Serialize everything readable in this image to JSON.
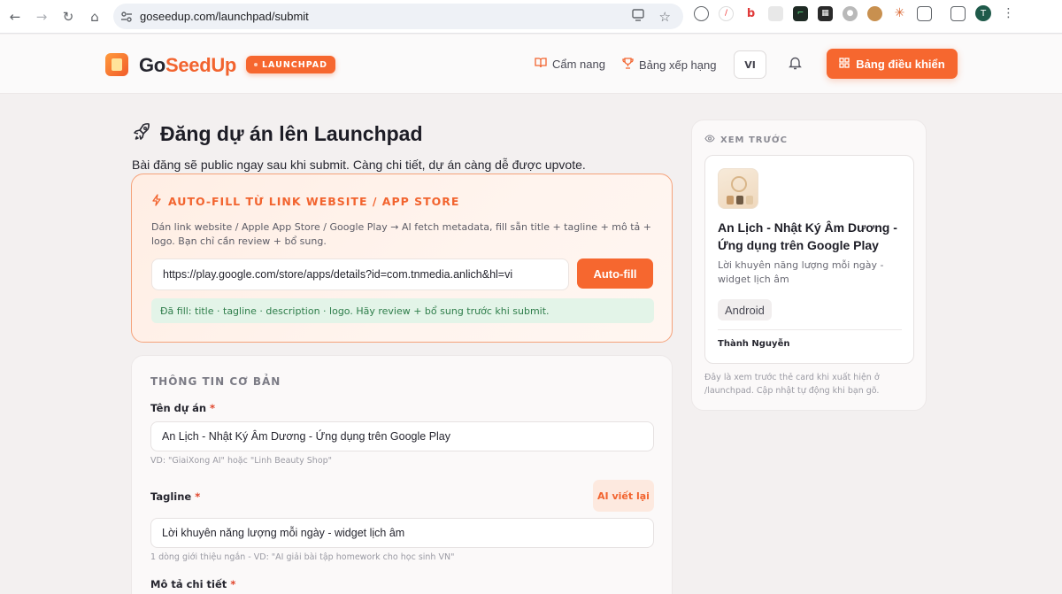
{
  "browser": {
    "url": "goseedup.com/launchpad/submit",
    "profile_initial": "T"
  },
  "header": {
    "brand_go": "Go",
    "brand_seedup": "SeedUp",
    "badge": "LAUNCHPAD",
    "nav": [
      {
        "label": "Cẩm nang",
        "icon": "book-icon"
      },
      {
        "label": "Bảng xếp hạng",
        "icon": "trophy-icon"
      }
    ],
    "lang": "VI",
    "dashboard_label": "Bảng điều khiển"
  },
  "main": {
    "title": "Đăng dự án lên Launchpad",
    "subtitle": "Bài đăng sẽ public ngay sau khi submit. Càng chi tiết, dự án càng dễ được upvote.",
    "autofill": {
      "title": "AUTO-FILL TỪ LINK WEBSITE / APP STORE",
      "description": "Dán link website / Apple App Store / Google Play → AI fetch metadata, fill sẵn title + tagline + mô tả + logo. Bạn chỉ cần review + bổ sung.",
      "url_value": "https://play.google.com/store/apps/details?id=com.tnmedia.anlich&hl=vi",
      "button_label": "Auto-fill",
      "status": "Đã fill: title · tagline · description · logo. Hãy review + bổ sung trước khi submit."
    },
    "basic_info": {
      "section_title": "THÔNG TIN CƠ BẢN",
      "name_label": "Tên dự án",
      "name_value": "An Lịch - Nhật Ký Âm Dương - Ứng dụng trên Google Play",
      "name_hint": "VD: \"GiaiXong AI\" hoặc \"Linh Beauty Shop\"",
      "tagline_label": "Tagline",
      "ai_rewrite_label": "AI viết lại",
      "tagline_value": "Lời khuyên năng lượng mỗi ngày - widget lịch âm",
      "tagline_hint": "1 dòng giới thiệu ngắn - VD: \"AI giải bài tập homework cho học sinh VN\"",
      "description_label": "Mô tả chi tiết",
      "required_mark": "*"
    }
  },
  "preview": {
    "heading": "XEM TRƯỚC",
    "title": "An Lịch - Nhật Ký Âm Dương - Ứng dụng trên Google Play",
    "tagline": "Lời khuyên năng lượng mỗi ngày - widget lịch âm",
    "platform": "Android",
    "author": "Thành Nguyễn",
    "note": "Đây là xem trước thẻ card khi xuất hiện ở /launchpad. Cập nhật tự động khi bạn gõ."
  },
  "colors": {
    "accent": "#f6672f",
    "success_bg": "#e3f4e8",
    "success_text": "#2e7d4a"
  }
}
